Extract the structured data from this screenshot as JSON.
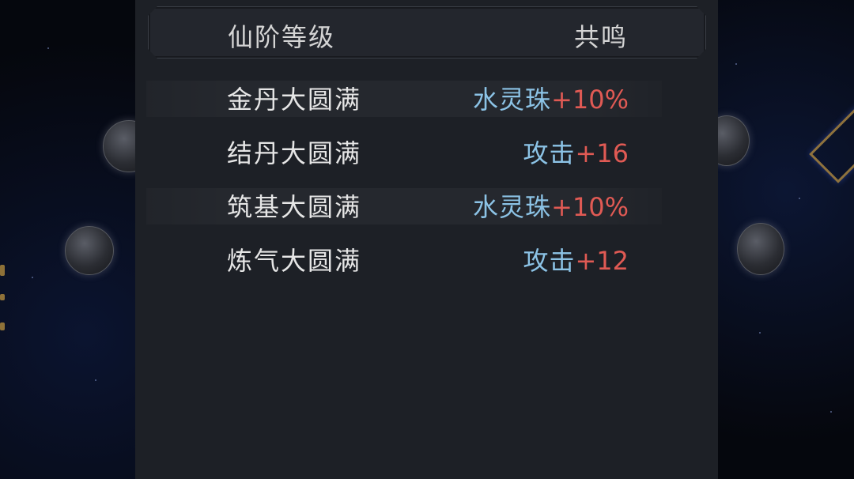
{
  "table": {
    "headers": {
      "level": "仙阶等级",
      "resonance": "共鸣"
    },
    "rows": [
      {
        "realm": "金丹大圆满",
        "stat": "水灵珠",
        "value": "+10%"
      },
      {
        "realm": "结丹大圆满",
        "stat": "攻击",
        "value": "+16"
      },
      {
        "realm": "筑基大圆满",
        "stat": "水灵珠",
        "value": "+10%"
      },
      {
        "realm": "炼气大圆满",
        "stat": "攻击",
        "value": "+12"
      }
    ]
  },
  "colors": {
    "panel_bg": "#1d2026",
    "header_text": "#d4d4d4",
    "realm_text": "#e6e6e6",
    "stat_name": "#8cc3e6",
    "stat_value": "#e05a54"
  }
}
